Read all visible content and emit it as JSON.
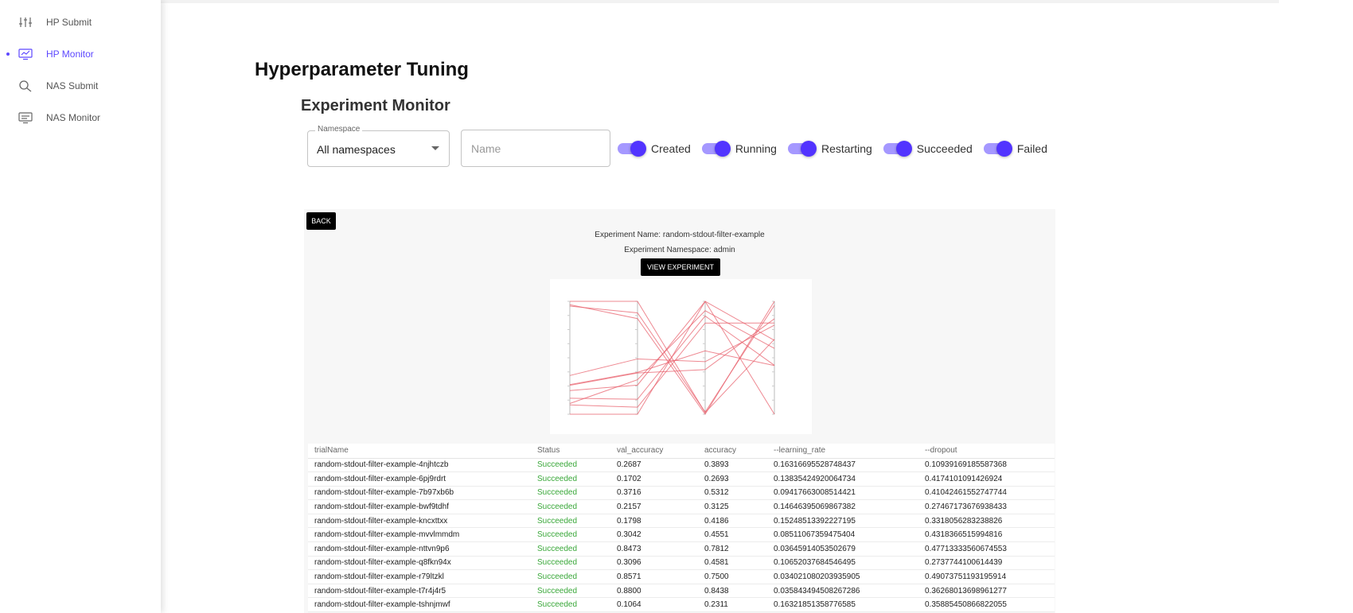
{
  "sidebar": {
    "items": [
      {
        "label": "HP Submit",
        "icon": "sliders-icon"
      },
      {
        "label": "HP Monitor",
        "icon": "monitor-icon",
        "active": true
      },
      {
        "label": "NAS Submit",
        "icon": "search-icon"
      },
      {
        "label": "NAS Monitor",
        "icon": "monitor-icon"
      }
    ]
  },
  "page": {
    "title": "Hyperparameter Tuning",
    "section": "Experiment Monitor"
  },
  "filters": {
    "namespace_label": "Namespace",
    "namespace_value": "All namespaces",
    "name_placeholder": "Name",
    "toggles": [
      {
        "label": "Created",
        "on": true
      },
      {
        "label": "Running",
        "on": true
      },
      {
        "label": "Restarting",
        "on": true
      },
      {
        "label": "Succeeded",
        "on": true
      },
      {
        "label": "Failed",
        "on": true
      }
    ]
  },
  "detail": {
    "back_label": "BACK",
    "experiment_name": "Experiment Name: random-stdout-filter-example",
    "experiment_namespace": "Experiment Namespace: admin",
    "view_label": "VIEW EXPERIMENT"
  },
  "colors": {
    "accent": "#5d48ff",
    "switch_track": "#a598ff",
    "switch_knob": "#5234ff",
    "succeeded": "#3aa83a",
    "chart_line": "#e8606c"
  },
  "chart_data": {
    "type": "parallel-coordinates",
    "axes": [
      "val_accuracy",
      "accuracy",
      "--learning_rate",
      "--dropout"
    ],
    "series_source": "table.rows"
  },
  "table": {
    "columns": [
      "trialName",
      "Status",
      "val_accuracy",
      "accuracy",
      "--learning_rate",
      "--dropout"
    ],
    "rows": [
      {
        "trialName": "random-stdout-filter-example-4njhtczb",
        "Status": "Succeeded",
        "val_accuracy": "0.2687",
        "accuracy": "0.3893",
        "learning_rate": "0.16316695528748437",
        "dropout": "0.10939169185587368"
      },
      {
        "trialName": "random-stdout-filter-example-6pj9rdrt",
        "Status": "Succeeded",
        "val_accuracy": "0.1702",
        "accuracy": "0.2693",
        "learning_rate": "0.13835424920064734",
        "dropout": "0.4174101091426924"
      },
      {
        "trialName": "random-stdout-filter-example-7b97xb6b",
        "Status": "Succeeded",
        "val_accuracy": "0.3716",
        "accuracy": "0.5312",
        "learning_rate": "0.09417663008514421",
        "dropout": "0.41042461552747744"
      },
      {
        "trialName": "random-stdout-filter-example-bwf9tdhf",
        "Status": "Succeeded",
        "val_accuracy": "0.2157",
        "accuracy": "0.3125",
        "learning_rate": "0.14646395069867382",
        "dropout": "0.27467173676938433"
      },
      {
        "trialName": "random-stdout-filter-example-kncxttxx",
        "Status": "Succeeded",
        "val_accuracy": "0.1798",
        "accuracy": "0.4186",
        "learning_rate": "0.15248513392227195",
        "dropout": "0.3318056283238826"
      },
      {
        "trialName": "random-stdout-filter-example-mvvlmmdm",
        "Status": "Succeeded",
        "val_accuracy": "0.3042",
        "accuracy": "0.4551",
        "learning_rate": "0.08511067359475404",
        "dropout": "0.4318366515994816"
      },
      {
        "trialName": "random-stdout-filter-example-nttvn9p6",
        "Status": "Succeeded",
        "val_accuracy": "0.8473",
        "accuracy": "0.7812",
        "learning_rate": "0.03645914053502679",
        "dropout": "0.47713333560674553"
      },
      {
        "trialName": "random-stdout-filter-example-q8fkn94x",
        "Status": "Succeeded",
        "val_accuracy": "0.3096",
        "accuracy": "0.4581",
        "learning_rate": "0.10652037684546495",
        "dropout": "0.2737744100614439"
      },
      {
        "trialName": "random-stdout-filter-example-r79ltzkl",
        "Status": "Succeeded",
        "val_accuracy": "0.8571",
        "accuracy": "0.7500",
        "learning_rate": "0.034021080203935905",
        "dropout": "0.49073751193195914"
      },
      {
        "trialName": "random-stdout-filter-example-t7r4j4r5",
        "Status": "Succeeded",
        "val_accuracy": "0.8800",
        "accuracy": "0.8438",
        "learning_rate": "0.035843494508267286",
        "dropout": "0.36268013698961277"
      },
      {
        "trialName": "random-stdout-filter-example-tshnjmwf",
        "Status": "Succeeded",
        "val_accuracy": "0.1064",
        "accuracy": "0.2311",
        "learning_rate": "0.16321851358776585",
        "dropout": "0.35885450866822055"
      }
    ]
  }
}
